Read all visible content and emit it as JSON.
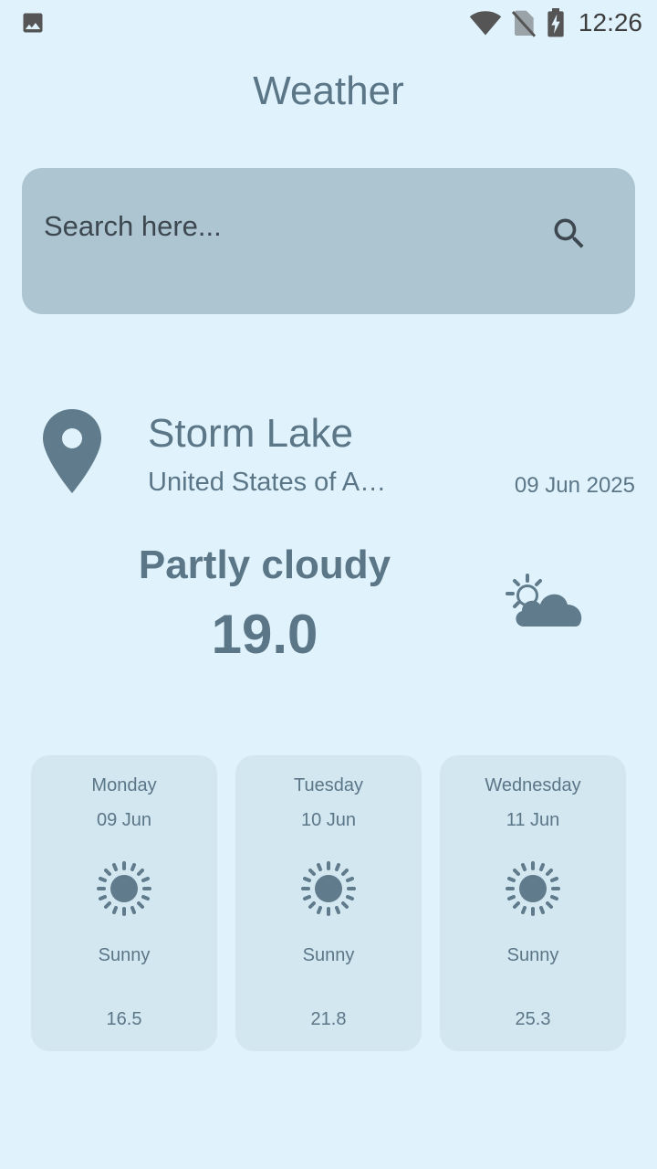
{
  "status_bar": {
    "time": "12:26",
    "icons": [
      "image-icon",
      "wifi-icon",
      "no-sim-icon",
      "battery-charging-icon"
    ]
  },
  "app": {
    "title": "Weather"
  },
  "search": {
    "placeholder": "Search here...",
    "value": "",
    "icon": "search-icon"
  },
  "location": {
    "icon": "location-pin-icon",
    "city": "Storm Lake",
    "country": "United States of America",
    "date": "09 Jun 2025"
  },
  "current": {
    "condition": "Partly cloudy",
    "temperature": "19.0",
    "icon": "partly-cloudy-icon"
  },
  "forecast": [
    {
      "day": "Monday",
      "date": "09 Jun",
      "condition": "Sunny",
      "temperature": "16.5",
      "icon": "sun-icon"
    },
    {
      "day": "Tuesday",
      "date": "10 Jun",
      "condition": "Sunny",
      "temperature": "21.8",
      "icon": "sun-icon"
    },
    {
      "day": "Wednesday",
      "date": "11 Jun",
      "condition": "Sunny",
      "temperature": "25.3",
      "icon": "sun-icon"
    }
  ],
  "colors": {
    "background": "#e0f3fd",
    "search_bg": "#acc5d1",
    "card_bg": "#d3e7f1",
    "text": "#5b7687",
    "icon": "#607b8b"
  }
}
